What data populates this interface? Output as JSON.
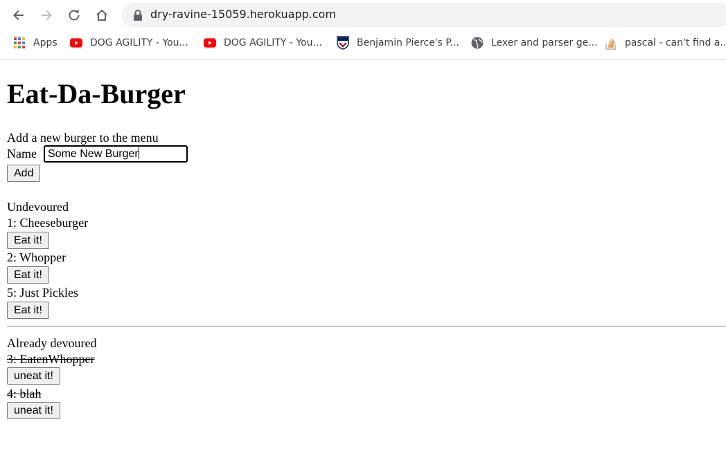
{
  "browser": {
    "url": "dry-ravine-15059.herokuapp.com",
    "nav_icons": [
      "back-arrow-icon",
      "forward-arrow-icon",
      "reload-icon",
      "home-icon",
      "lock-icon"
    ],
    "bookmarks": [
      {
        "label": "Apps",
        "icon": "apps-grid-icon"
      },
      {
        "label": "DOG AGILITY - You...",
        "icon": "youtube-icon"
      },
      {
        "label": "DOG AGILITY - You...",
        "icon": "youtube-icon"
      },
      {
        "label": "Benjamin Pierce's P...",
        "icon": "penn-shield-icon"
      },
      {
        "label": "Lexer and parser ge...",
        "icon": "globe-icon"
      },
      {
        "label": "pascal - can't find a...",
        "icon": "stackoverflow-icon"
      }
    ]
  },
  "page": {
    "title": "Eat-Da-Burger",
    "add_form": {
      "heading": "Add a new burger to the menu",
      "name_label": "Name",
      "name_value": "Some New Burger",
      "add_button": "Add"
    },
    "undevoured": {
      "heading": "Undevoured",
      "items": [
        {
          "label": "1: Cheeseburger",
          "button": "Eat it!"
        },
        {
          "label": "2: Whopper",
          "button": "Eat it!"
        },
        {
          "label": "5: Just Pickles",
          "button": "Eat it!"
        }
      ]
    },
    "devoured": {
      "heading": "Already devoured",
      "items": [
        {
          "label": "3: EatenWhopper",
          "button": "uneat it!"
        },
        {
          "label": "4: blah",
          "button": "uneat it!"
        }
      ]
    }
  }
}
